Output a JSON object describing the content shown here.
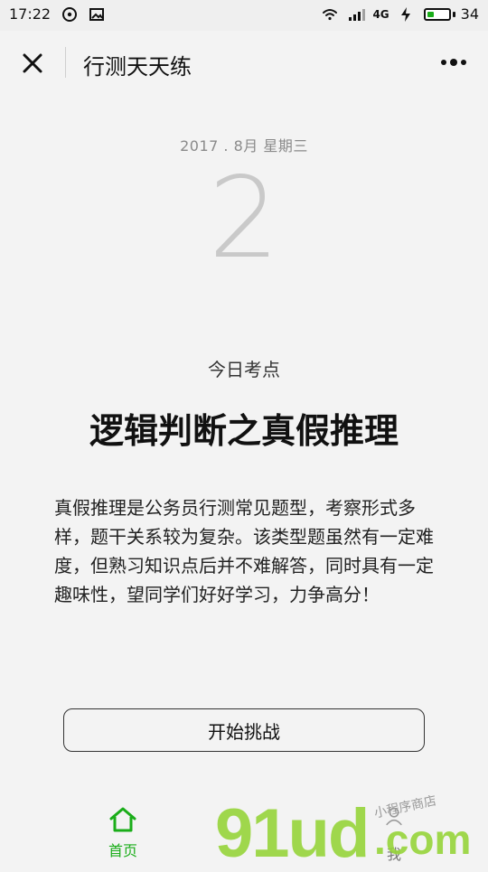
{
  "status_bar": {
    "time": "17:22",
    "battery_level": "34",
    "battery_fraction": 0.34,
    "signal_label": "4G",
    "icons": [
      "wechat-icon",
      "image-icon",
      "wifi-icon",
      "signal-icon",
      "charging-icon",
      "battery-icon"
    ]
  },
  "header": {
    "title": "行测天天练",
    "close_icon": "close-icon",
    "more_icon": "more-dots-icon"
  },
  "content": {
    "date": "2017 . 8月 星期三",
    "day": "2",
    "kaodian_label": "今日考点",
    "topic": "逻辑判断之真假推理",
    "description": "真假推理是公务员行测常见题型，考察形式多样，题干关系较为复杂。该类型题虽然有一定难度，但熟习知识点后并不难解答，同时具有一定趣味性，望同学们好好学习，力争高分！",
    "start_button": "开始挑战"
  },
  "bottom_nav": {
    "home_label": "首页",
    "me_label": "我",
    "active_color": "#1aad19"
  },
  "watermark": {
    "main": "91ud",
    "com": ".com",
    "sub": "小程序商店"
  }
}
